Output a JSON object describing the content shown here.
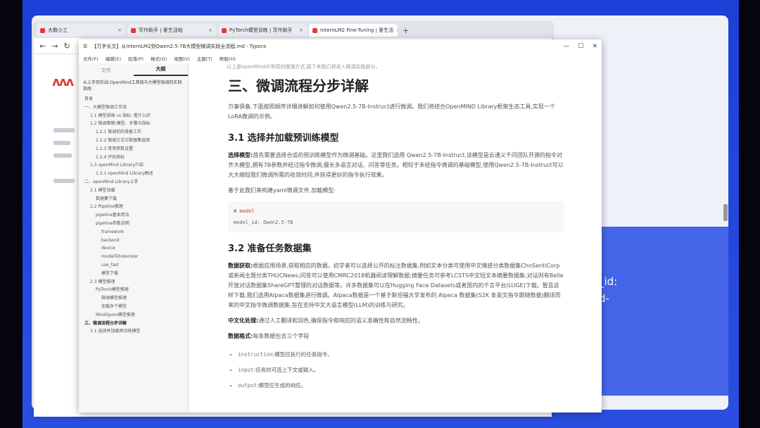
{
  "browser": {
    "tabs": [
      {
        "label": "大数小工"
      },
      {
        "label": "写作助手 | 爱生活帖"
      },
      {
        "label": "PyTorch模型训练 | 写作助手"
      },
      {
        "label": "InternLM2 Fine-Tuning | 爱生活"
      }
    ],
    "new_tab": "+"
  },
  "typora": {
    "title": "【万字长文】从InternLM2到Qwen2.5-7B大模型微调实践全流程.md - Typora",
    "menu": [
      "文件(F)",
      "编辑(E)",
      "段落(P)",
      "格式(O)",
      "视图(V)",
      "主题(T)",
      "帮助(H)"
    ],
    "sidebar_tabs": [
      "文件",
      "大纲"
    ],
    "file_title": "从上手到实战:OpenMind工具链与大模型微调的实践指南",
    "outline": [
      {
        "text": "目录",
        "indent": 0
      },
      {
        "text": "一、大模型微调工作流",
        "indent": 0
      },
      {
        "text": "1.1 模型规格 vs 指标: 看什么好",
        "indent": 1
      },
      {
        "text": "1.2 微调策略:模型、步骤与指标",
        "indent": 1
      },
      {
        "text": "1.2.1 微调前的准备工作",
        "indent": 2
      },
      {
        "text": "1.2.2 微调方式与数据集选择",
        "indent": 2
      },
      {
        "text": "1.2.3 常用参数设置",
        "indent": 2
      },
      {
        "text": "1.2.4 评估指标",
        "indent": 2
      },
      {
        "text": "1.3 openMind Library介绍",
        "indent": 1
      },
      {
        "text": "1.3.1 openMind Library概述",
        "indent": 2
      },
      {
        "text": "二、openMind Library上手",
        "indent": 0
      },
      {
        "text": "2.1 模型加载",
        "indent": 1
      },
      {
        "text": "数据集下载",
        "indent": 2
      },
      {
        "text": "2.2 Pipeline推理",
        "indent": 1
      },
      {
        "text": "pipeline基本用法",
        "indent": 2
      },
      {
        "text": "pipeline参数说明",
        "indent": 2
      },
      {
        "text": "framework",
        "indent": 3
      },
      {
        "text": "backend",
        "indent": 3
      },
      {
        "text": "device",
        "indent": 3
      },
      {
        "text": "model与tokenizer",
        "indent": 3
      },
      {
        "text": "use_fast",
        "indent": 3
      },
      {
        "text": "模型下载",
        "indent": 3
      },
      {
        "text": "2.3 模型推理",
        "indent": 1
      },
      {
        "text": "PyTorch模型推理",
        "indent": 2
      },
      {
        "text": "微调模型推理",
        "indent": 3
      },
      {
        "text": "加载多个模型",
        "indent": 3
      },
      {
        "text": "MindSpore模型推理",
        "indent": 2
      },
      {
        "text": "三、微调流程分步详解",
        "indent": 0,
        "bold": true
      },
      {
        "text": "3.1 选择并加载预训练模型",
        "indent": 1
      }
    ],
    "content": {
      "top_text": "以上是openMind中常用的推理方式,接下来我们将进入微调实践部分。",
      "h2": "三、微调流程分步详解",
      "intro": "万事俱备,下面按照顺序详细讲解如何使用Qwen2.5-7B-Instruct进行微调。我们将结合OpenMIND Library框架生态工具,实现一个LoRA微调的示例。",
      "h3_1": "3.1 选择并加载预训练模型",
      "p1_lead": "选择模型:",
      "p1": "首先需要选择合适的预训练模型作为微调基础。这里我们选用 Qwen2.5-7B-Instruct,该模型是云通义千问团队开源的指令对齐大模型,拥有7B参数并经过指令微调,擅长多语言对话、问答等任务。相较于未经指令微调的基础模型,使用Qwen2.5-7B-Instruct可以大大缩短我们微调所需的收敛时间,并获得更好的指令执行效果。",
      "p2": "基于此我们来构建yaml微调文件,加载模型:",
      "code_comment": "# model",
      "code_line": "model_id: Qwen2.5-7B",
      "h3_2": "3.2 准备任务数据集",
      "p3_lead": "数据获取:",
      "p3": "根据应用场景,获取相应的数据。初学者可以选择公开的标注数据集,例如文本分类可使用中文情感分类数据集ChnSentiCorp或新闻主题分类THUCNews;问答可以使用CMRC2018机器阅读理解数据;摘要任务可参考LCSTS中文短文本摘要数据集;对话则有Belle开放对话数据集ShareGPT整理的对话数据等。许多数据集可以在Hugging Face Datasets或者国内的千言平台(LUGE)下载。暂且这样下载,我们选用Alpaca数据集进行微调。Alpaca数据是一个基于斯坦福大学发布的 Alpaca 数据集(52K 条英文指令跟随数据)翻译而来的中文指令微调数据集,旨在支持中文大语言模型(LLM)的训练与研究。",
      "p4_lead": "中文化处理:",
      "p4": "通过人工翻译和润色,确保指令和响应的语义准确性和自然流畅性。",
      "p5_lead": "数据格式:",
      "p5": "每条数据包含三个字段",
      "fields": [
        {
          "name": "instruction",
          "desc": ":模型应执行的任务指令。"
        },
        {
          "name": "input",
          "desc": ":任务的可选上下文或输入。"
        },
        {
          "name": "output",
          "desc": ":模型应生成的响应。"
        }
      ]
    }
  },
  "slide": {
    "deco_text_1": "_id:",
    "deco_text_2": "d-"
  }
}
